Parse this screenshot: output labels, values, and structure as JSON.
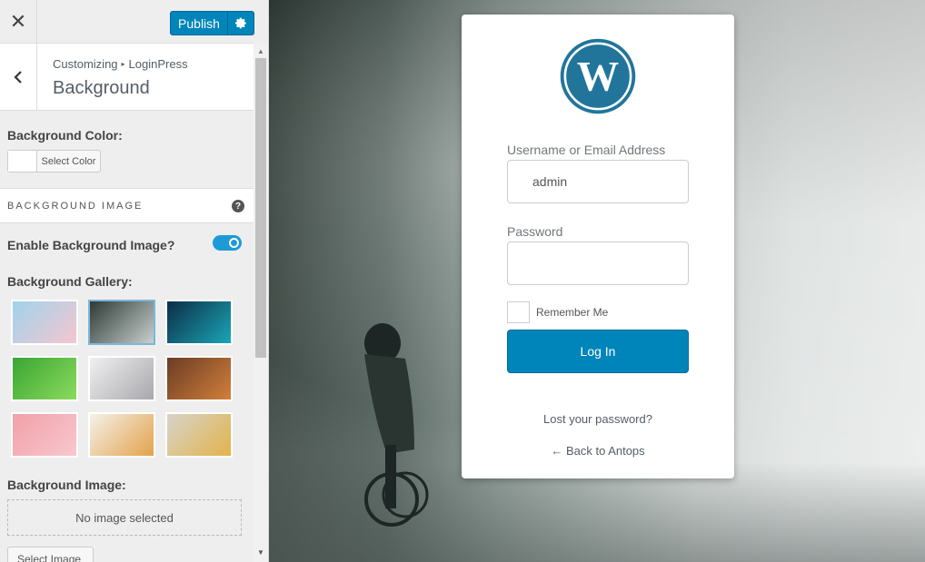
{
  "toolbar": {
    "close_icon": "close-icon",
    "publish_label": "Publish",
    "settings_icon": "gear-icon"
  },
  "section": {
    "breadcrumb_parent": "Customizing",
    "breadcrumb_child": "LoginPress",
    "title": "Background",
    "back_icon": "chevron-left-icon"
  },
  "controls": {
    "bg_color_label": "Background Color:",
    "select_color_label": "Select Color",
    "bg_image_group": "BACKGROUND IMAGE",
    "help_icon_text": "?",
    "enable_bg_image_label": "Enable Background Image?",
    "enable_bg_image": true,
    "gallery_label": "Background Gallery:",
    "gallery": [
      {
        "name": "gallery-login-preview",
        "colors": [
          "#9fd3ec",
          "#f6c6cf"
        ],
        "selected": false
      },
      {
        "name": "gallery-forest-cyclist",
        "colors": [
          "#2d3a36",
          "#c9d0ce"
        ],
        "selected": true
      },
      {
        "name": "gallery-aurora",
        "colors": [
          "#0d2d46",
          "#1aa6b7"
        ],
        "selected": false
      },
      {
        "name": "gallery-green-leaves",
        "colors": [
          "#3aa535",
          "#8bdb5c"
        ],
        "selected": false
      },
      {
        "name": "gallery-cat",
        "colors": [
          "#f0f0f2",
          "#a8a8ac"
        ],
        "selected": false
      },
      {
        "name": "gallery-shop",
        "colors": [
          "#6b3c25",
          "#d27f3a"
        ],
        "selected": false
      },
      {
        "name": "gallery-pink-wood",
        "colors": [
          "#f2a0a9",
          "#f8c7cd"
        ],
        "selected": false
      },
      {
        "name": "gallery-pencils",
        "colors": [
          "#f4f1ea",
          "#e3a24b"
        ],
        "selected": false
      },
      {
        "name": "gallery-food",
        "colors": [
          "#d7d4cb",
          "#e2b34a"
        ],
        "selected": false
      }
    ],
    "bg_image_label": "Background Image:",
    "no_image_text": "No image selected",
    "select_image_label": "Select Image"
  },
  "login": {
    "username_label": "Username or Email Address",
    "username_value": "admin",
    "password_label": "Password",
    "password_value": "",
    "remember_label": "Remember Me",
    "login_button": "Log In",
    "lost_password": "Lost your password?",
    "back_link": "← Back to Antops"
  },
  "colors": {
    "accent": "#0085ba",
    "wp_blue": "#21759b"
  }
}
